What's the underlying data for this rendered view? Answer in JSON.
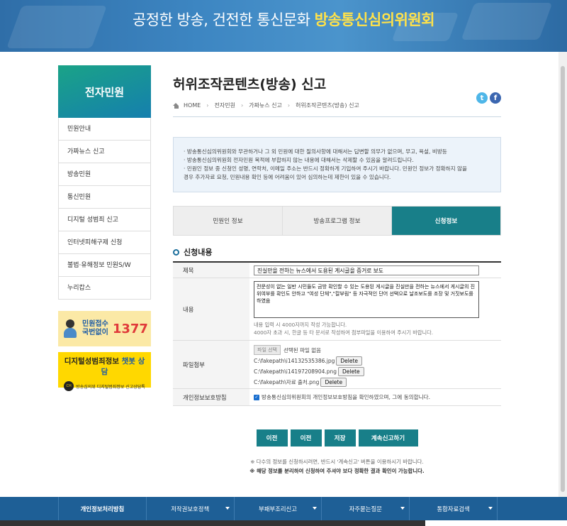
{
  "banner": {
    "slogan": "공정한 방송, 건전한 통신문화",
    "org": "방송통신심의위원회"
  },
  "sidebar": {
    "title": "전자민원",
    "items": [
      {
        "label": "민원안내"
      },
      {
        "label": "가짜뉴스 신고"
      },
      {
        "label": "방송민원"
      },
      {
        "label": "통신민원"
      },
      {
        "label": "디지털 성범죄 신고"
      },
      {
        "label": "인터넷피해구제 신청"
      },
      {
        "label": "불법·유해정보 민원S/W"
      },
      {
        "label": "누리캅스"
      }
    ],
    "promo1": {
      "line1": "민원접수",
      "line2": "국번없이",
      "number": "1377"
    },
    "promo2": {
      "line1a": "디지털성범죄정보 ",
      "line1b": "챗봇 상담",
      "line2": "방송심의위 디지털범죄정보 신고상담톡",
      "badge": "CH"
    }
  },
  "main": {
    "title": "허위조작콘텐츠(방송) 신고",
    "breadcrumb": [
      "HOME",
      "전자민원",
      "가짜뉴스 신고",
      "허위조작콘텐츠(방송) 신고"
    ],
    "sns": {
      "twitter": "t",
      "facebook": "f"
    },
    "notice": [
      "· 방송통신심의위원회와 무관하거나 그 외 민원에 대한 질의사항에 대해서는 답변할 의무가 없으며, 무고, 욕설, 비방등",
      "· 방송통신심의위원회 전자민원 목적에 부합하지 않는 내용에 대해서는 삭제할 수 있음을 알려드립니다.",
      "· 민원인 정보 중 신청인 성명, 연락처, 이메일 주소는 반드시 정확하게 기입하여 주시기 바랍니다. 민원인 정보가 정확하지 않을",
      "경우 추가자료 요청, 민원내용 확인 등에 어려움이 있어 심의하는데 제한이 있을 수 있습니다."
    ],
    "tabs": [
      {
        "label": "민원인 정보",
        "active": false
      },
      {
        "label": "방송프로그램 정보",
        "active": false
      },
      {
        "label": "신청정보",
        "active": true
      }
    ],
    "section_title": "신청내용",
    "form": {
      "subject_label": "제목",
      "subject_value": "진실만을 전하는 뉴스에서 도용된 게시글을 증거로 보도",
      "content_label": "내용",
      "content_value": "전문성이 없는 일반 시민들도 금방 확인할 수 있는 도용된 게시글을 진실만을 전하는 뉴스에서 게시글의 진위여부를 확인도 안하고 \"여성 단체\",\"칼부림\" 등 자극적인 단어 선택으로 날조보도를 조장 및 거짓보도를 하였음",
      "content_help1": "내용 입력 시 4000자까지 작성 가능합니다.",
      "content_help2": "4000자 초과 시, 한글 등 타 문서로 작성하여 첨부파일을 이용하여 주시기 바랍니다.",
      "file_label": "파일첨부",
      "file_button": "파일 선택",
      "file_status": "선택된 파일 없음",
      "files": [
        {
          "path": "C:\\fakepath\\i14132535386.jpg",
          "delete": "Delete"
        },
        {
          "path": "C:\\fakepath\\i14197208904.png",
          "delete": "Delete"
        },
        {
          "path": "C:\\fakepath\\자료 출처.png",
          "delete": "Delete"
        }
      ],
      "privacy_label": "개인정보보호방침",
      "privacy_text": "방송통신심의위원회의 개인정보보호방침을 확인하였으며, 그에 동의합니다."
    },
    "buttons": [
      "이전",
      "이전",
      "저장",
      "계속신고하기"
    ],
    "foot_note1": "※ 다수의 정보를 신청하시려면, 반드시 '계속신고' 버튼을 이용하시기 바랍니다.",
    "foot_note2": "※ 해당 정보를 분리하여 신청하여 주셔야 보다 정확한 결과 확인이 가능합니다."
  },
  "footer": {
    "items": [
      "개인정보처리방침",
      "저작권보호정책",
      "부패부조리신고",
      "자주묻는질문",
      "통합자료검색"
    ]
  }
}
